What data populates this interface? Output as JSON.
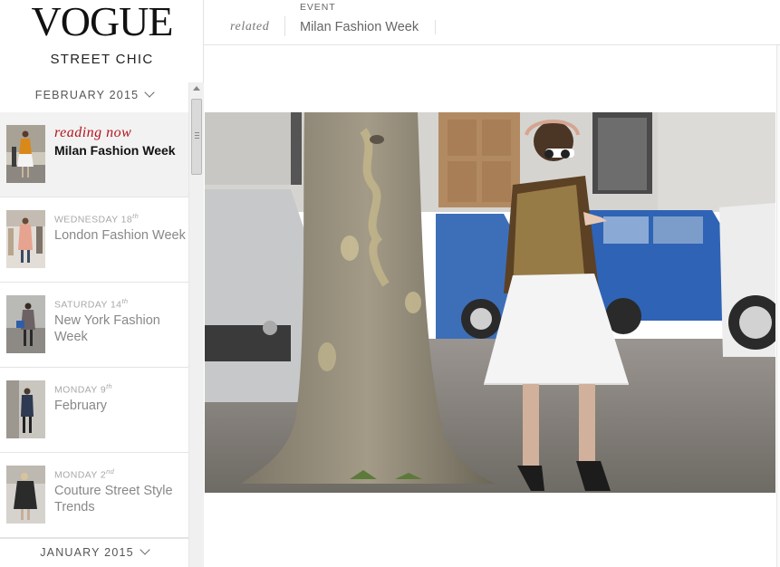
{
  "brand": {
    "logo": "VOGUE",
    "section": "STREET CHIC"
  },
  "sidebar": {
    "month_current": "FEBRUARY 2015",
    "month_next": "JANUARY 2015",
    "reading_now_label": "reading now",
    "items": [
      {
        "day": "",
        "suffix": "",
        "title": "Milan Fashion Week",
        "active": true
      },
      {
        "day": "WEDNESDAY 18",
        "suffix": "th",
        "title": "London Fashion Week"
      },
      {
        "day": "SATURDAY 14",
        "suffix": "th",
        "title": "New York Fashion Week"
      },
      {
        "day": "MONDAY 9",
        "suffix": "th",
        "title": "February"
      },
      {
        "day": "MONDAY 2",
        "suffix": "nd",
        "title": "Couture Street Style Trends"
      }
    ]
  },
  "topbar": {
    "related_label": "related",
    "event_label": "EVENT",
    "event_name": "Milan Fashion Week"
  },
  "icons": {
    "month_toggle": "chevron-down-icon",
    "scroll_up": "scroll-up-arrow-icon"
  },
  "colors": {
    "accent_red": "#b4141e",
    "active_bg": "#f2f2f2"
  }
}
